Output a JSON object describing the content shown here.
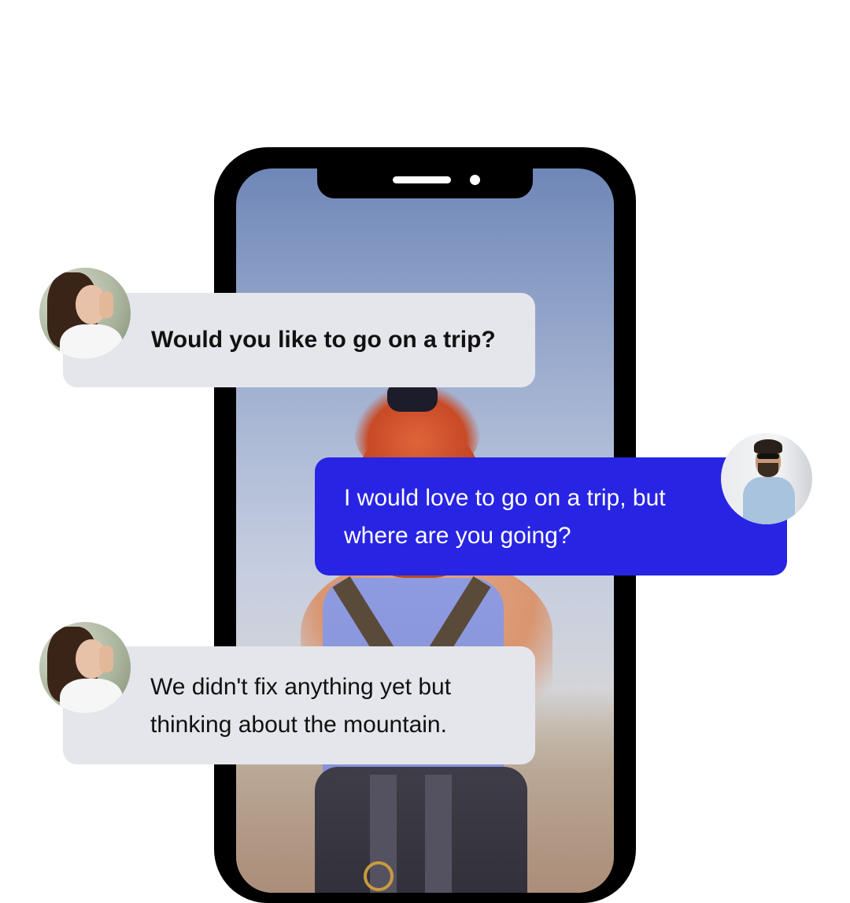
{
  "colors": {
    "background": "#ffffff",
    "phone_frame": "#000000",
    "bubble_received": "#e5e6eb",
    "bubble_sent": "#2824e3",
    "text_received": "#111111",
    "text_sent": "#ffffff"
  },
  "chat": {
    "messages": [
      {
        "sender": "woman",
        "side": "left",
        "avatar_icon": "woman-avatar",
        "text": "Would you like to go on a trip?"
      },
      {
        "sender": "man",
        "side": "right",
        "avatar_icon": "man-avatar",
        "text": "I would love to go on a trip, but where are you going?"
      },
      {
        "sender": "woman",
        "side": "left",
        "avatar_icon": "woman-avatar",
        "text": "We didn't fix anything yet but thinking about the mountain."
      }
    ]
  }
}
